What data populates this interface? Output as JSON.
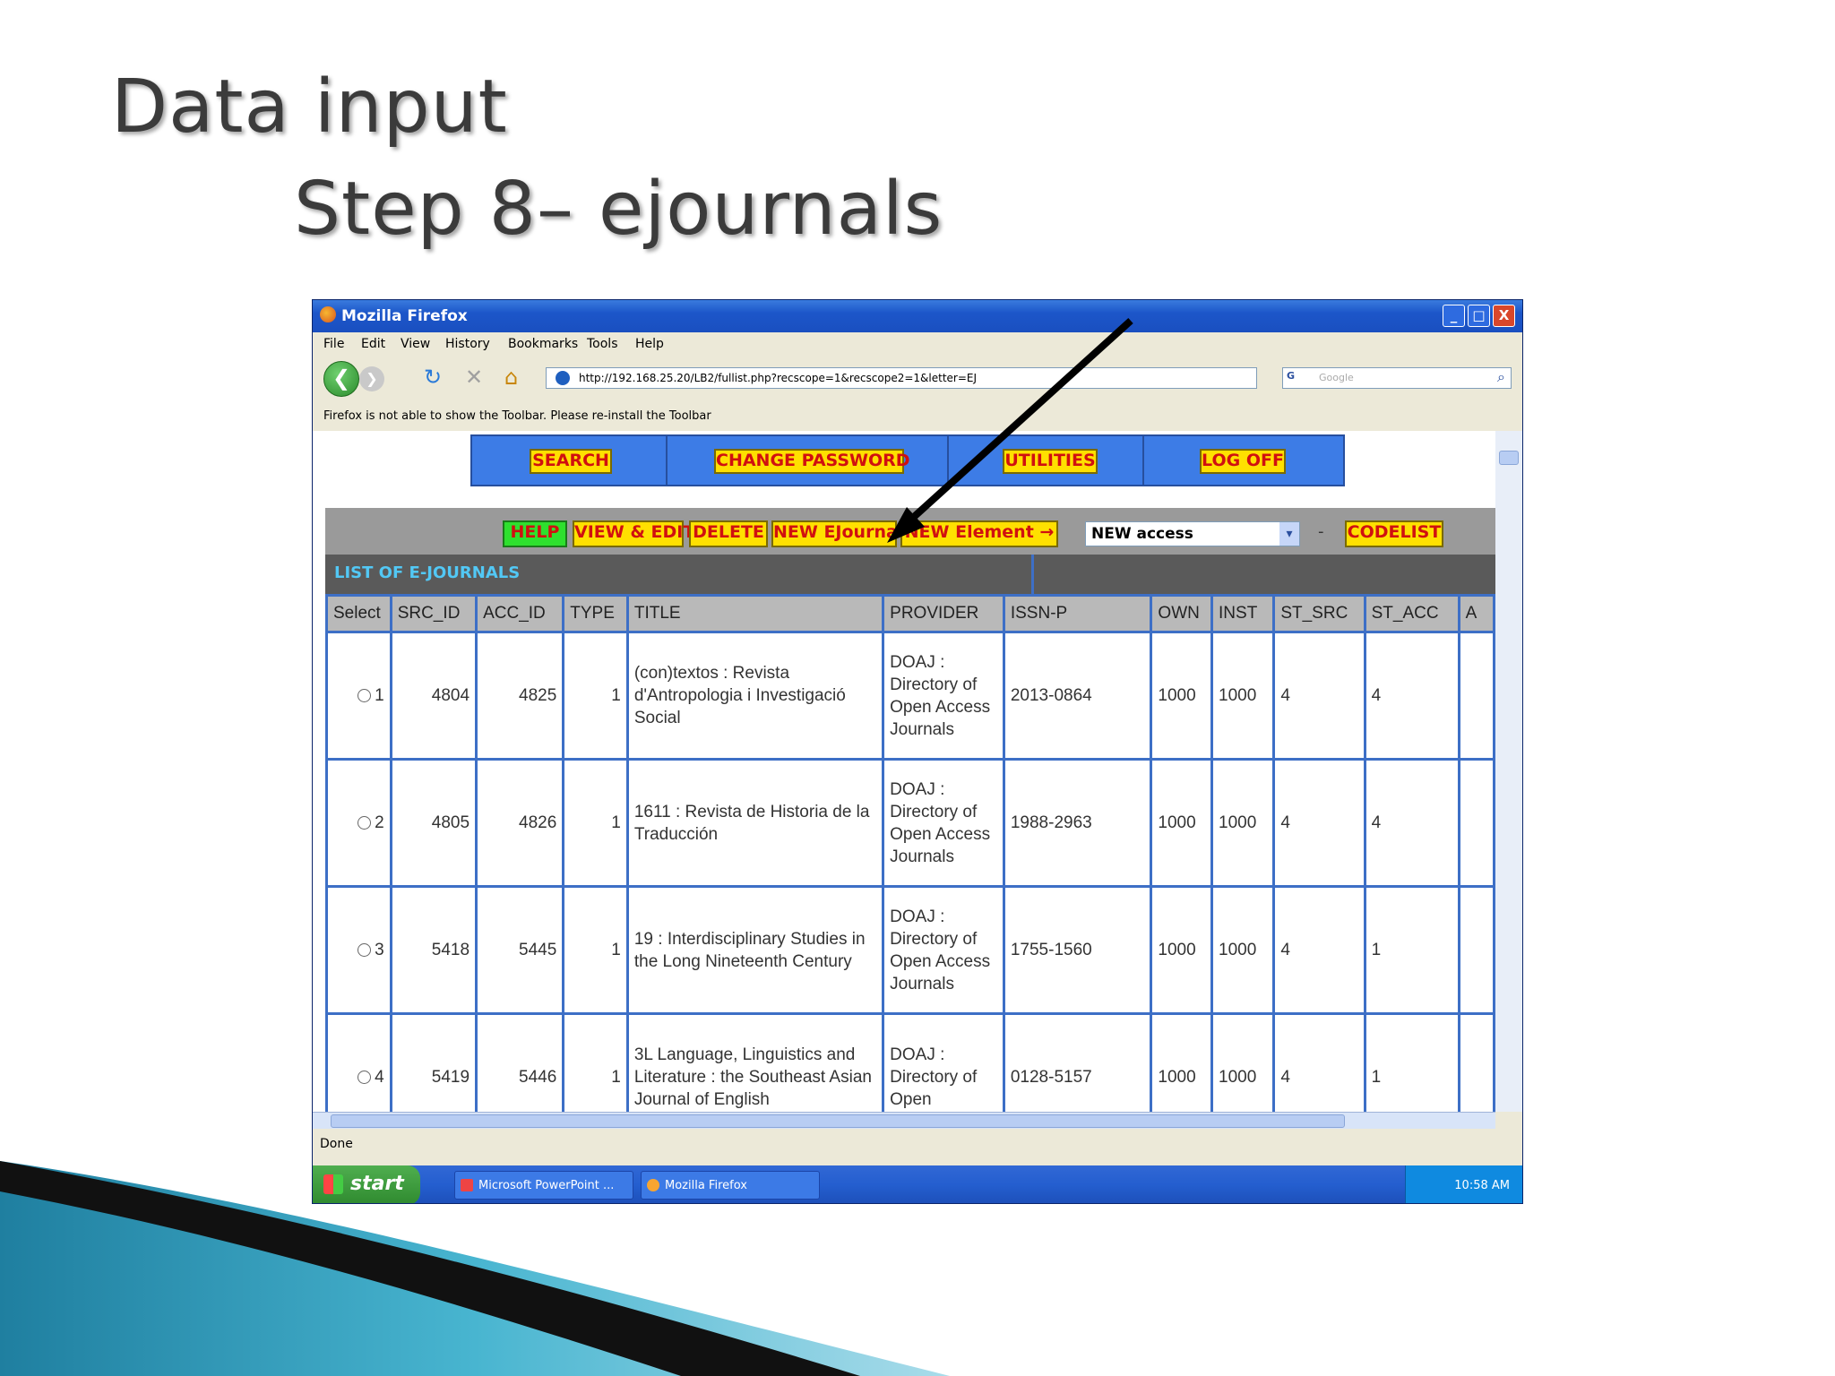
{
  "slide": {
    "title": "Data input",
    "subtitle": "Step 8– ejournals"
  },
  "browser": {
    "window_title": "Mozilla Firefox",
    "menu": [
      "File",
      "Edit",
      "View",
      "History",
      "Bookmarks",
      "Tools",
      "Help"
    ],
    "url": "http://192.168.25.20/LB2/fullist.php?recscope=1&recscope2=1&letter=EJ",
    "search_placeholder": "Google",
    "toolbar_message": "Firefox is not able to show the Toolbar. Please re-install the Toolbar",
    "status": "Done",
    "window_buttons": [
      "_",
      "□",
      "X"
    ]
  },
  "top_nav": [
    "SEARCH",
    "CHANGE PASSWORD",
    "UTILITIES",
    "LOG OFF"
  ],
  "action_bar": {
    "help": "HELP",
    "view_edit": "VIEW & EDIT",
    "delete": "DELETE",
    "new_ejournal": "NEW EJournal",
    "new_element": "NEW Element →",
    "new_access_selected": "NEW access",
    "dash": "-",
    "codelist": "CODELIST"
  },
  "list_title": "LIST OF E-JOURNALS",
  "table": {
    "headers": [
      "Select",
      "SRC_ID",
      "ACC_ID",
      "TYPE",
      "TITLE",
      "PROVIDER",
      "ISSN-P",
      "OWN",
      "INST",
      "ST_SRC",
      "ST_ACC",
      "A"
    ],
    "rows": [
      {
        "select": "1",
        "src_id": "4804",
        "acc_id": "4825",
        "type": "1",
        "title": "(con)textos : Revista d'Antropologia i Investigació Social",
        "provider": "DOAJ : Directory of Open Access Journals",
        "issn": "2013-0864",
        "own": "1000",
        "inst": "1000",
        "st_src": "4",
        "st_acc": "4"
      },
      {
        "select": "2",
        "src_id": "4805",
        "acc_id": "4826",
        "type": "1",
        "title": "1611 : Revista de Historia de la Traducción",
        "provider": "DOAJ : Directory of Open Access Journals",
        "issn": "1988-2963",
        "own": "1000",
        "inst": "1000",
        "st_src": "4",
        "st_acc": "4"
      },
      {
        "select": "3",
        "src_id": "5418",
        "acc_id": "5445",
        "type": "1",
        "title": "19 : Interdisciplinary Studies in the Long Nineteenth Century",
        "provider": "DOAJ : Directory of Open Access Journals",
        "issn": "1755-1560",
        "own": "1000",
        "inst": "1000",
        "st_src": "4",
        "st_acc": "1"
      },
      {
        "select": "4",
        "src_id": "5419",
        "acc_id": "5446",
        "type": "1",
        "title": "3L Language, Linguistics and Literature : the Southeast Asian Journal of English",
        "provider": "DOAJ : Directory of Open",
        "issn": "0128-5157",
        "own": "1000",
        "inst": "1000",
        "st_src": "4",
        "st_acc": "1"
      }
    ]
  },
  "taskbar": {
    "start": "start",
    "items": [
      "Microsoft PowerPoint ...",
      "Mozilla Firefox"
    ],
    "clock": "10:58 AM"
  }
}
